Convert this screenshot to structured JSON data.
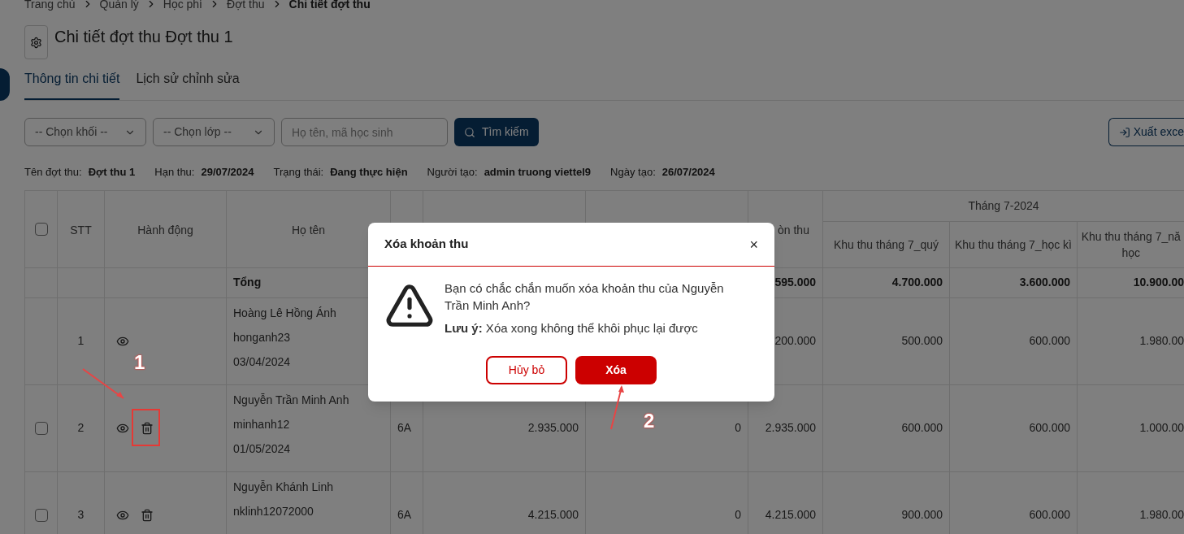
{
  "breadcrumb": [
    {
      "label": "Trang chủ",
      "current": false
    },
    {
      "label": "Quản lý",
      "current": false
    },
    {
      "label": "Học phí",
      "current": false
    },
    {
      "label": "Đợt thu",
      "current": false
    },
    {
      "label": "Chi tiết đợt thu",
      "current": true
    }
  ],
  "title": "Chi tiết đợt thu Đợt thu 1",
  "tabs": [
    {
      "label": "Thông tin chi tiết",
      "selected": true
    },
    {
      "label": "Lịch sử chỉnh sửa",
      "selected": false
    }
  ],
  "filters": {
    "grade_select": "-- Chọn khối --",
    "class_select": "-- Chọn lớp --",
    "search_placeholder": "Họ tên, mã học sinh",
    "search_button": "Tìm kiếm",
    "export_button": "Xuất exce"
  },
  "info": [
    {
      "label": "Tên đợt thu:",
      "value": "Đợt thu 1"
    },
    {
      "label": "Hạn thu:",
      "value": "29/07/2024"
    },
    {
      "label": "Trạng thái:",
      "value": "Đang thực hiện"
    },
    {
      "label": "Người tạo:",
      "value": "admin truong viettel9"
    },
    {
      "label": "Ngày tạo:",
      "value": "26/07/2024"
    }
  ],
  "table": {
    "select_all_checked": false,
    "columns": [
      {
        "label": "STT"
      },
      {
        "label": "Hành động"
      },
      {
        "label": "Họ tên"
      },
      {},
      {},
      {},
      {
        "label": "òn thu"
      }
    ],
    "group": {
      "label": "Tháng 7-2024",
      "columns": [
        "Khu thu tháng 7_quý",
        "Khu thu tháng 7_học kì",
        "Khu thu tháng 7_nă\nhọc"
      ]
    },
    "total": {
      "label": "Tổng",
      "remaining": "595.000",
      "values": [
        "4.700.000",
        "3.600.000",
        "10.900.00"
      ]
    },
    "rows": [
      {
        "stt": "1",
        "show_checkbox": false,
        "show_delete": false,
        "name": "Hoàng Lê Hồng Ánh",
        "code": "honganh23",
        "date": "03/04/2024",
        "remaining": "200.000",
        "values": [
          "500.000",
          "600.000",
          "1.980.00"
        ]
      },
      {
        "stt": "2",
        "checked": false,
        "show_checkbox": true,
        "show_delete": true,
        "name": "Nguyễn Trần Minh Anh",
        "code": "minhanh12",
        "date": "01/05/2024",
        "class": "6A",
        "amount": "2.935.000",
        "paid": "0",
        "remaining": "2.935.000",
        "values": [
          "600.000",
          "600.000",
          "1.000.00"
        ]
      },
      {
        "stt": "3",
        "checked": false,
        "show_checkbox": true,
        "show_delete": true,
        "name": "Nguyễn Khánh Linh",
        "code": "nklinh12072000",
        "class": "6A",
        "amount": "4.215.000",
        "paid": "0",
        "remaining": "4.215.000",
        "values": [
          "900.000",
          "600.000",
          "1.980.00"
        ]
      }
    ]
  },
  "dialog": {
    "title": "Xóa khoản thu",
    "close": "×",
    "message": "Bạn có chắc chắn muốn xóa khoản thu của Nguyễn Trần Minh Anh?",
    "note": "**Lưu ý:** Xóa xong không thể khôi phục lại được",
    "cancel": "Hủy bỏ",
    "confirm": "Xóa"
  },
  "annotations": [
    "1",
    "2"
  ]
}
